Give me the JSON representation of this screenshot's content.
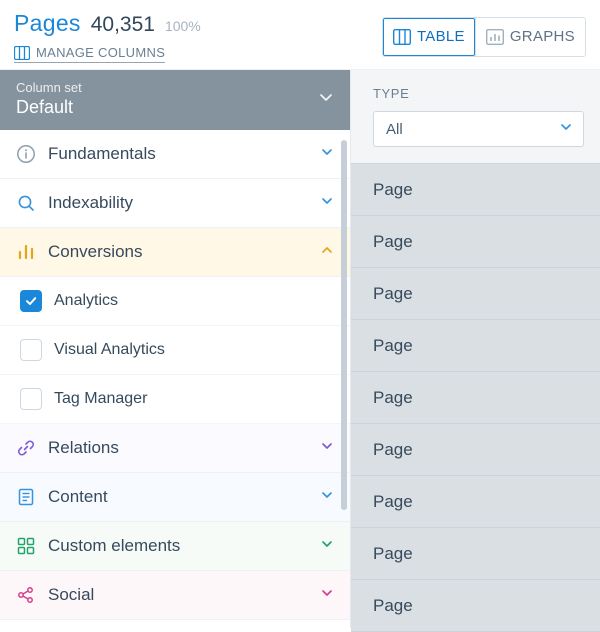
{
  "header": {
    "title": "Pages",
    "count": "40,351",
    "percent": "100%",
    "manage_label": "MANAGE COLUMNS",
    "view": {
      "table": "TABLE",
      "graphs": "GRAPHS"
    }
  },
  "column_set": {
    "label": "Column set",
    "value": "Default"
  },
  "categories": [
    {
      "key": "fund",
      "label": "Fundamentals",
      "expanded": false,
      "children": []
    },
    {
      "key": "index",
      "label": "Indexability",
      "expanded": false,
      "children": []
    },
    {
      "key": "conv",
      "label": "Conversions",
      "expanded": true,
      "children": [
        {
          "label": "Analytics",
          "checked": true
        },
        {
          "label": "Visual Analytics",
          "checked": false
        },
        {
          "label": "Tag Manager",
          "checked": false
        }
      ]
    },
    {
      "key": "rel",
      "label": "Relations",
      "expanded": false,
      "children": []
    },
    {
      "key": "content",
      "label": "Content",
      "expanded": false,
      "children": []
    },
    {
      "key": "custom",
      "label": "Custom elements",
      "expanded": false,
      "children": []
    },
    {
      "key": "social",
      "label": "Social",
      "expanded": false,
      "children": []
    }
  ],
  "filter": {
    "type_label": "TYPE",
    "type_selected": "All"
  },
  "rows": [
    {
      "type": "Page"
    },
    {
      "type": "Page"
    },
    {
      "type": "Page"
    },
    {
      "type": "Page"
    },
    {
      "type": "Page"
    },
    {
      "type": "Page"
    },
    {
      "type": "Page"
    },
    {
      "type": "Page"
    },
    {
      "type": "Page"
    }
  ]
}
